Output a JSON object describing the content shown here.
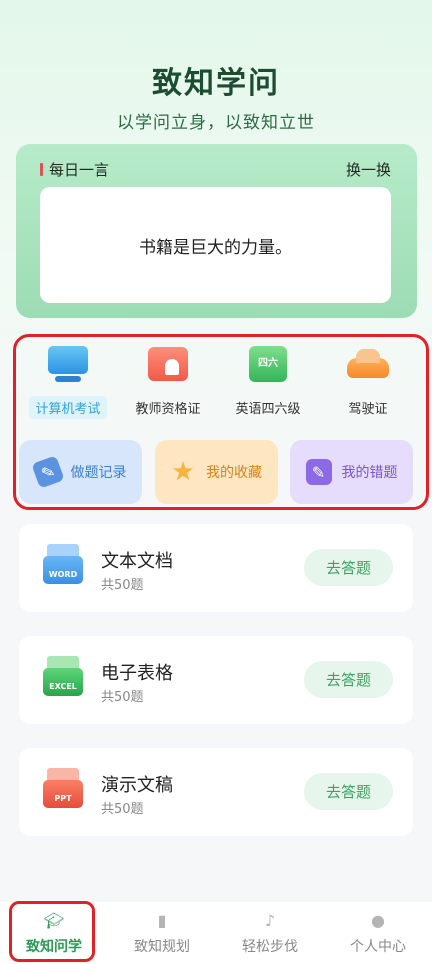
{
  "header": {
    "title": "致知学问",
    "subtitle": "以学问立身，以致知立世"
  },
  "daily_quote": {
    "label": "每日一言",
    "refresh_label": "换一换",
    "text": "书籍是巨大的力量。"
  },
  "categories": [
    {
      "label": "计算机考试",
      "icon": "computer-icon",
      "active": true
    },
    {
      "label": "教师资格证",
      "icon": "teacher-certificate-icon",
      "active": false
    },
    {
      "label": "英语四六级",
      "icon": "cet-book-icon",
      "icon_text": "四六",
      "active": false
    },
    {
      "label": "驾驶证",
      "icon": "car-icon",
      "active": false
    }
  ],
  "quick_actions": [
    {
      "label": "做题记录",
      "icon": "pencil-icon"
    },
    {
      "label": "我的收藏",
      "icon": "star-icon"
    },
    {
      "label": "我的错题",
      "icon": "note-edit-icon"
    }
  ],
  "subjects": [
    {
      "title": "文本文档",
      "count": "共50题",
      "action": "去答题",
      "icon": "word-document-icon",
      "badge": "WORD"
    },
    {
      "title": "电子表格",
      "count": "共50题",
      "action": "去答题",
      "icon": "excel-spreadsheet-icon",
      "badge": "EXCEL"
    },
    {
      "title": "演示文稿",
      "count": "共50题",
      "action": "去答题",
      "icon": "ppt-presentation-icon",
      "badge": "PPT"
    }
  ],
  "tabbar": [
    {
      "label": "致知问学",
      "icon": "graduation-cap-icon",
      "active": true
    },
    {
      "label": "致知规划",
      "icon": "book-icon",
      "active": false
    },
    {
      "label": "轻松步伐",
      "icon": "music-note-icon",
      "active": false
    },
    {
      "label": "个人中心",
      "icon": "user-chat-icon",
      "active": false
    }
  ],
  "colors": {
    "brand": "#2f9a57",
    "highlight": "#e32027",
    "quote_card": "#a8e3bf"
  }
}
